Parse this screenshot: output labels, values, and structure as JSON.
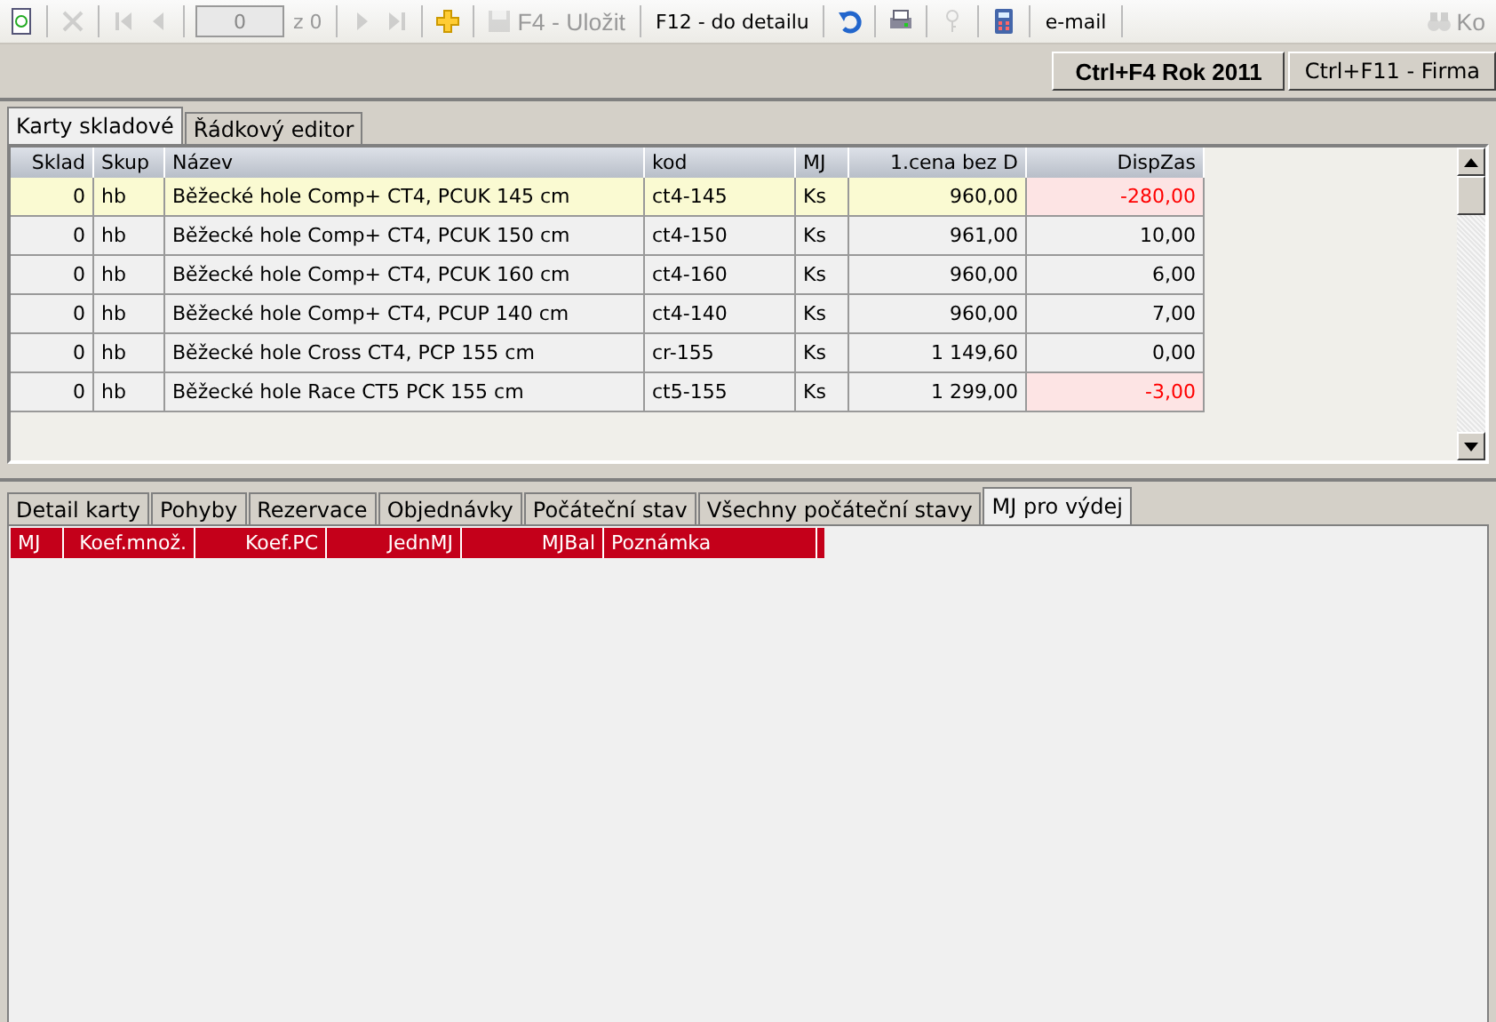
{
  "toolbar": [
    {
      "kind": "refresh",
      "disabled": false
    },
    {
      "kind": "sep"
    },
    {
      "kind": "delete",
      "disabled": true
    },
    {
      "kind": "sep"
    },
    {
      "kind": "first",
      "disabled": true
    },
    {
      "kind": "prev",
      "disabled": true
    },
    {
      "kind": "sep"
    },
    {
      "kind": "field",
      "value": "0"
    },
    {
      "kind": "text",
      "label": "z 0",
      "disabled": true
    },
    {
      "kind": "sep"
    },
    {
      "kind": "next",
      "disabled": true
    },
    {
      "kind": "last",
      "disabled": true
    },
    {
      "kind": "sep"
    },
    {
      "kind": "add",
      "disabled": false
    },
    {
      "kind": "sep"
    },
    {
      "kind": "save",
      "label": "F4 - Uložit",
      "disabled": true
    },
    {
      "kind": "sep"
    },
    {
      "kind": "text",
      "label": "F12 - do detailu",
      "disabled": false
    },
    {
      "kind": "sep"
    },
    {
      "kind": "undo",
      "disabled": false
    },
    {
      "kind": "sep"
    },
    {
      "kind": "print",
      "disabled": false
    },
    {
      "kind": "sep"
    },
    {
      "kind": "key",
      "disabled": true
    },
    {
      "kind": "sep"
    },
    {
      "kind": "calculator",
      "disabled": false
    },
    {
      "kind": "sep"
    },
    {
      "kind": "text",
      "label": "e-mail",
      "disabled": false
    },
    {
      "kind": "sep"
    },
    {
      "kind": "spacer"
    },
    {
      "kind": "find",
      "label": "Ko",
      "disabled": true
    }
  ],
  "top_buttons": [
    {
      "label": "Ctrl+F4 Rok 2011",
      "bold": true
    },
    {
      "label": "Ctrl+F11 - Firma",
      "bold": false
    }
  ],
  "upper_tabs": [
    {
      "label": "Karty skladové",
      "selected": true
    },
    {
      "label": "Řádkový editor",
      "selected": false
    }
  ],
  "table": {
    "columns": [
      {
        "label": "Sklad"
      },
      {
        "label": "Skup"
      },
      {
        "label": "Název"
      },
      {
        "label": "kod"
      },
      {
        "label": "MJ"
      },
      {
        "label": "1.cena bez D"
      },
      {
        "label": "DispZas"
      }
    ],
    "rows": [
      {
        "selected": true,
        "alert": true,
        "cells": [
          "0",
          "hb",
          "Běžecké hole Comp+ CT4, PCUK 145 cm",
          "ct4-145",
          "Ks",
          "960,00",
          "-280,00"
        ]
      },
      {
        "selected": false,
        "alert": false,
        "cells": [
          "0",
          "hb",
          "Běžecké hole Comp+ CT4, PCUK 150 cm",
          "ct4-150",
          "Ks",
          "961,00",
          "10,00"
        ]
      },
      {
        "selected": false,
        "alert": false,
        "cells": [
          "0",
          "hb",
          "Běžecké hole Comp+ CT4, PCUK 160 cm",
          "ct4-160",
          "Ks",
          "960,00",
          "6,00"
        ]
      },
      {
        "selected": false,
        "alert": false,
        "cells": [
          "0",
          "hb",
          "Běžecké hole Comp+ CT4, PCUP 140 cm",
          "ct4-140",
          "Ks",
          "960,00",
          "7,00"
        ]
      },
      {
        "selected": false,
        "alert": false,
        "cells": [
          "0",
          "hb",
          "Běžecké hole Cross CT4, PCP 155 cm",
          "cr-155",
          "Ks",
          "1 149,60",
          "0,00"
        ]
      },
      {
        "selected": false,
        "alert": true,
        "cells": [
          "0",
          "hb",
          "Běžecké hole Race CT5 PCK 155 cm",
          "ct5-155",
          "Ks",
          "1 299,00",
          "-3,00"
        ]
      }
    ]
  },
  "lower_tabs": [
    {
      "label": "Detail karty",
      "selected": false
    },
    {
      "label": "Pohyby",
      "selected": false
    },
    {
      "label": "Rezervace",
      "selected": false
    },
    {
      "label": "Objednávky",
      "selected": false
    },
    {
      "label": "Počáteční stav",
      "selected": false
    },
    {
      "label": "Všechny počáteční stavy",
      "selected": false
    },
    {
      "label": "MJ pro výdej",
      "selected": true
    }
  ],
  "lower_table": {
    "columns": [
      {
        "label": "MJ"
      },
      {
        "label": "Koef.množ."
      },
      {
        "label": "Koef.PC"
      },
      {
        "label": "JednMJ"
      },
      {
        "label": "MJBal"
      },
      {
        "label": "Poznámka"
      }
    ]
  }
}
